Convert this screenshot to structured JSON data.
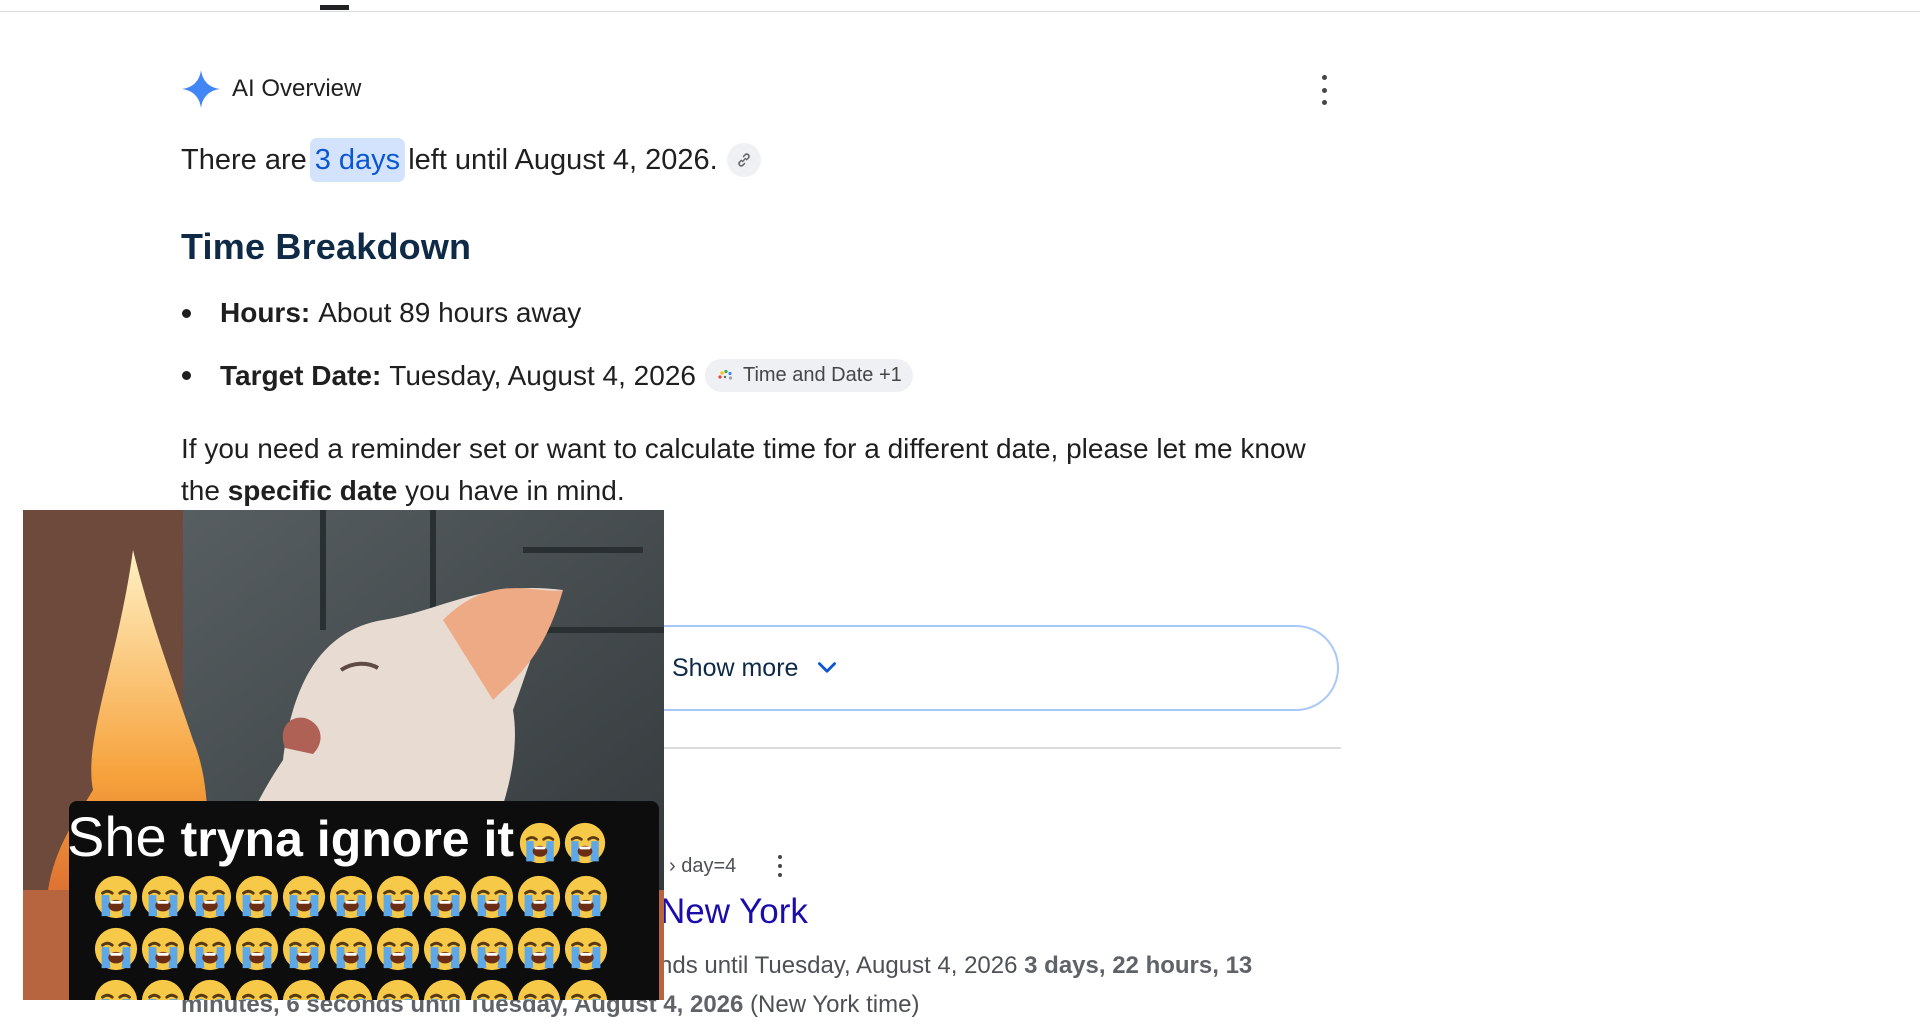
{
  "ai_overview": {
    "label": "AI Overview",
    "answer_prefix": "There are",
    "answer_highlight": "3 days",
    "answer_suffix": "left until August 4, 2026.",
    "heading": "Time Breakdown",
    "bullets": [
      {
        "label": "Hours:",
        "text": "About 89 hours away"
      },
      {
        "label": "Target Date:",
        "text": "Tuesday, August 4, 2026"
      }
    ],
    "source_chip": "Time and Date +1",
    "paragraph_prefix": "If you need a reminder set or want to calculate time for a different date, please let me know the",
    "paragraph_bold": "specific date",
    "paragraph_suffix": "you have in mind.",
    "show_more": "Show more"
  },
  "result": {
    "url_fragment": "› day=4",
    "title": "New York",
    "snippet_line1_plain": "nds until Tuesday, August 4, 2026",
    "snippet_line1_bold": "3 days, 22 hours, 13",
    "snippet_line2_bold": "minutes, 6 seconds until Tuesday, August 4, 2026",
    "snippet_line2_plain": "(New York time)"
  },
  "overlay": {
    "caption_first": "She",
    "caption_rest": "tryna ignore it"
  },
  "colors": {
    "accent_blue": "#0b57d0",
    "highlight_bg": "#d3e3fd",
    "link_title": "#1a0dab",
    "heading": "#0e2a47"
  },
  "icons": [
    "sparkle-icon",
    "more-vert-icon",
    "link-icon",
    "time-and-date-logo-icon",
    "chevron-down-icon",
    "loudly-crying-emoji-icon"
  ]
}
